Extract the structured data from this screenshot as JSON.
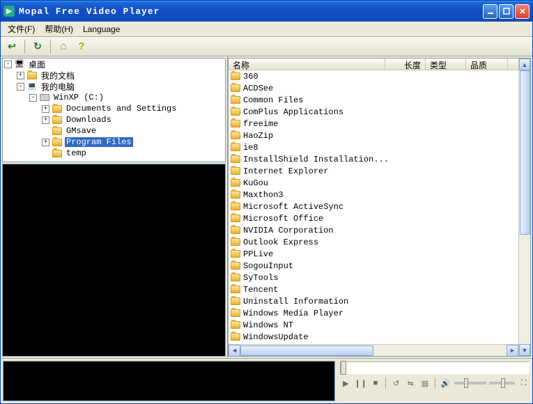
{
  "title": "Mopal Free Video Player",
  "menu": {
    "file": "文件(F)",
    "help": "帮助(H)",
    "language": "Language"
  },
  "tree": {
    "root": "桌面",
    "nodes": [
      {
        "indent": 0,
        "toggle": "-",
        "icon": "desktop",
        "label": "桌面"
      },
      {
        "indent": 1,
        "toggle": "+",
        "icon": "folder",
        "label": "我的文档"
      },
      {
        "indent": 1,
        "toggle": "-",
        "icon": "computer",
        "label": "我的电脑"
      },
      {
        "indent": 2,
        "toggle": "-",
        "icon": "drive",
        "label": "WinXP (C:)"
      },
      {
        "indent": 3,
        "toggle": "+",
        "icon": "folder",
        "label": "Documents and Settings"
      },
      {
        "indent": 3,
        "toggle": "+",
        "icon": "folder",
        "label": "Downloads"
      },
      {
        "indent": 3,
        "toggle": "",
        "icon": "folder",
        "label": "GMsave"
      },
      {
        "indent": 3,
        "toggle": "+",
        "icon": "folder",
        "label": "Program Files",
        "selected": true
      },
      {
        "indent": 3,
        "toggle": "",
        "icon": "folder",
        "label": "temp"
      }
    ]
  },
  "list": {
    "headers": {
      "name": "名称",
      "length": "长度",
      "type": "类型",
      "quality": "品质"
    },
    "col_widths": {
      "name": 225,
      "length": 58,
      "type": 58,
      "quality": 60
    },
    "items": [
      "360",
      "ACDSee",
      "Common Files",
      "ComPlus Applications",
      "freeime",
      "HaoZip",
      "ie8",
      "InstallShield Installation...",
      "Internet Explorer",
      "KuGou",
      "Maxthon3",
      "Microsoft ActiveSync",
      "Microsoft Office",
      "NVIDIA Corporation",
      "Outlook Express",
      "PPLive",
      "SogouInput",
      "SyTools",
      "Tencent",
      "Uninstall Information",
      "Windows Media Player",
      "Windows NT",
      "WindowsUpdate"
    ]
  },
  "icons": {
    "back": "↩",
    "refresh": "↻",
    "home": "⌂",
    "help": "?",
    "play": "▶",
    "pause": "❙❙",
    "stop": "■",
    "repeat": "↺",
    "shuffle": "⇋",
    "playlist": "▤",
    "speaker": "🔊",
    "fullscreen": "⛶"
  }
}
